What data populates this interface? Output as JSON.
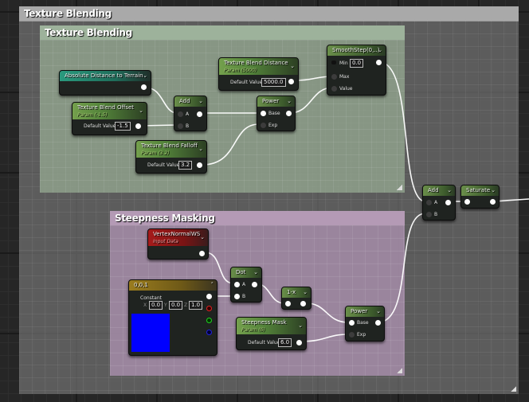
{
  "comments": {
    "outer": {
      "title": "Texture Blending"
    },
    "texture_blending": {
      "title": "Texture Blending"
    },
    "steepness_masking": {
      "title": "Steepness Masking"
    }
  },
  "nodes": {
    "abs_distance": {
      "title": "Absolute Distance to Terrain"
    },
    "blend_offset": {
      "title": "Texture Blend Offset",
      "subtitle": "Param (-1.5)",
      "default_label": "Default Value",
      "value": "-1.5"
    },
    "blend_falloff": {
      "title": "Texture Blend Falloff",
      "subtitle": "Param (3.2)",
      "default_label": "Default Value",
      "value": "3.2"
    },
    "blend_distance": {
      "title": "Texture Blend Distance",
      "subtitle": "Param (5000)",
      "default_label": "Default Value",
      "value": "5000.0"
    },
    "add1": {
      "title": "Add",
      "pin_a": "A",
      "pin_b": "B"
    },
    "power1": {
      "title": "Power",
      "pin_base": "Base",
      "pin_exp": "Exp"
    },
    "smoothstep": {
      "title": "SmoothStep(0,..)",
      "pin_min": "Min",
      "min_value": "0.0",
      "pin_max": "Max",
      "pin_value": "Value"
    },
    "add2": {
      "title": "Add",
      "pin_a": "A",
      "pin_b": "B"
    },
    "saturate": {
      "title": "Saturate"
    },
    "vertex_normal": {
      "title": "VertexNormalWS",
      "subtitle": "Input Data"
    },
    "constant3": {
      "title": "0,0,1",
      "label": "Constant",
      "x_label": "X",
      "x": "0.0",
      "y_label": "Y",
      "y": "0.0",
      "z_label": "Z",
      "z": "1.0",
      "swatch_color": "#0000ff"
    },
    "dot": {
      "title": "Dot",
      "pin_a": "A",
      "pin_b": "B"
    },
    "one_minus": {
      "title": "1-x"
    },
    "steepness_mask": {
      "title": "Steepness Mask",
      "subtitle": "Param (6)",
      "default_label": "Default Value",
      "value": "6.0"
    },
    "power2": {
      "title": "Power",
      "pin_base": "Base",
      "pin_exp": "Exp"
    }
  }
}
